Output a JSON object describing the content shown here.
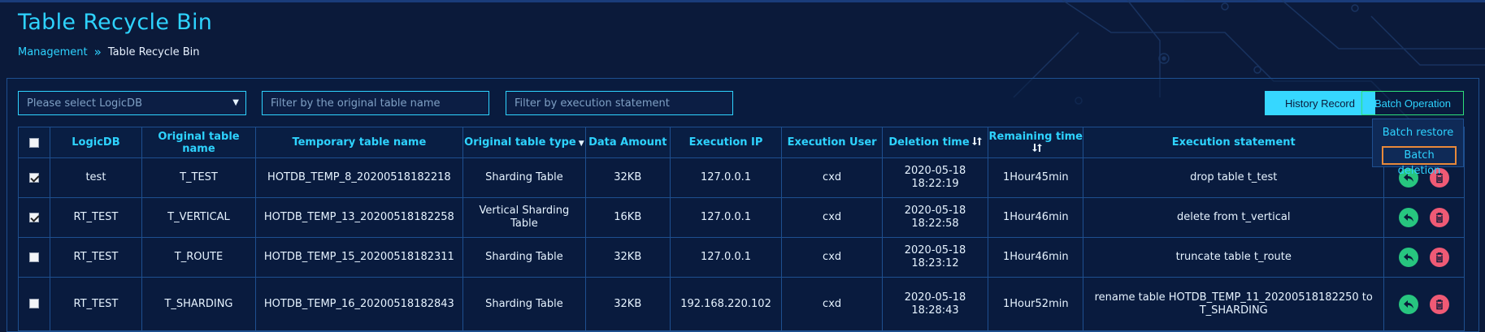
{
  "page": {
    "title": "Table Recycle Bin"
  },
  "breadcrumb": {
    "parent": "Management",
    "separator": "»",
    "current": "Table Recycle Bin"
  },
  "filters": {
    "logicdb_placeholder": "Please select LogicDB",
    "table_name_placeholder": "Filter by the original table name",
    "statement_placeholder": "Filter by execution statement"
  },
  "toolbar": {
    "history_label": "History Record",
    "batch_label": "Batch Operation"
  },
  "dropdown": {
    "restore_label": "Batch restore",
    "delete_label": "Batch deletion"
  },
  "table": {
    "headers": {
      "logicdb": "LogicDB",
      "original_name": "Original table name",
      "temp_name": "Temporary table name",
      "original_type": "Original table type",
      "data_amount": "Data Amount",
      "exec_ip": "Execution IP",
      "exec_user": "Execution User",
      "deletion_time": "Deletion time",
      "remaining_time": "Remaining time",
      "exec_statement": "Execution statement"
    },
    "rows": [
      {
        "checked": true,
        "logicdb": "test",
        "original_name": "T_TEST",
        "temp_name": "HOTDB_TEMP_8_20200518182218",
        "type": "Sharding Table",
        "amount": "32KB",
        "ip": "127.0.0.1",
        "user": "cxd",
        "deletion_date": "2020-05-18",
        "deletion_clock": "18:22:19",
        "remaining": "1Hour45min",
        "statement": "drop table t_test"
      },
      {
        "checked": true,
        "logicdb": "RT_TEST",
        "original_name": "T_VERTICAL",
        "temp_name": "HOTDB_TEMP_13_20200518182258",
        "type": "Vertical Sharding Table",
        "amount": "16KB",
        "ip": "127.0.0.1",
        "user": "cxd",
        "deletion_date": "2020-05-18",
        "deletion_clock": "18:22:58",
        "remaining": "1Hour46min",
        "statement": "delete from t_vertical"
      },
      {
        "checked": false,
        "logicdb": "RT_TEST",
        "original_name": "T_ROUTE",
        "temp_name": "HOTDB_TEMP_15_20200518182311",
        "type": "Sharding Table",
        "amount": "32KB",
        "ip": "127.0.0.1",
        "user": "cxd",
        "deletion_date": "2020-05-18",
        "deletion_clock": "18:23:12",
        "remaining": "1Hour46min",
        "statement": "truncate table t_route"
      },
      {
        "checked": false,
        "logicdb": "RT_TEST",
        "original_name": "T_SHARDING",
        "temp_name": "HOTDB_TEMP_16_20200518182843",
        "type": "Sharding Table",
        "amount": "32KB",
        "ip": "192.168.220.102",
        "user": "cxd",
        "deletion_date": "2020-05-18",
        "deletion_clock": "18:28:43",
        "remaining": "1Hour52min",
        "statement": "rename table HOTDB_TEMP_11_20200518182250 to T_SHARDING"
      }
    ]
  },
  "colors": {
    "accent": "#2ed3ff",
    "background": "#0b1a3a",
    "restore": "#27c57f",
    "delete": "#ef5a75",
    "highlight": "#e8893a"
  }
}
